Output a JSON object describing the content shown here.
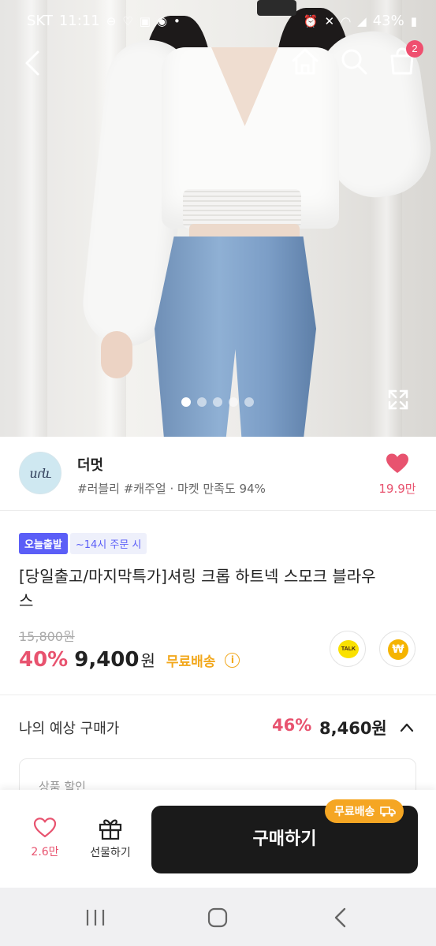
{
  "status_bar": {
    "carrier": "SKT",
    "time": "11:11",
    "battery": "43%"
  },
  "nav": {
    "cart_count": "2"
  },
  "gallery": {
    "total_images": 5,
    "current_index": 1
  },
  "shop": {
    "logo_text": "սɾև",
    "name": "더멋",
    "tags": "#러블리 #캐주얼 · 마켓 만족도 94%",
    "likes": "19.9만"
  },
  "product": {
    "badge_today": "오늘출발",
    "badge_time": "~14시 주문 시",
    "title": "[당일출고/마지막특가]셔링 크롭 하트넥 스모크 블라우스",
    "original_price": "15,800원",
    "discount": "40%",
    "price": "9,400",
    "price_unit": "원",
    "free_shipping": "무료배송",
    "talk_label": "TALK",
    "pay_label": "₩"
  },
  "expected": {
    "label": "나의 예상 구매가",
    "discount": "46%",
    "price": "8,460원"
  },
  "discount_card": {
    "title": "상품 할인"
  },
  "action_bar": {
    "wish_count": "2.6만",
    "gift_label": "선물하기",
    "buy_label": "구매하기",
    "ship_pill": "무료배송"
  },
  "colors": {
    "accent_pink": "#e8536f",
    "accent_orange": "#f5a623",
    "badge_blue": "#5b5ef7",
    "buy_button": "#1a1a1a"
  }
}
